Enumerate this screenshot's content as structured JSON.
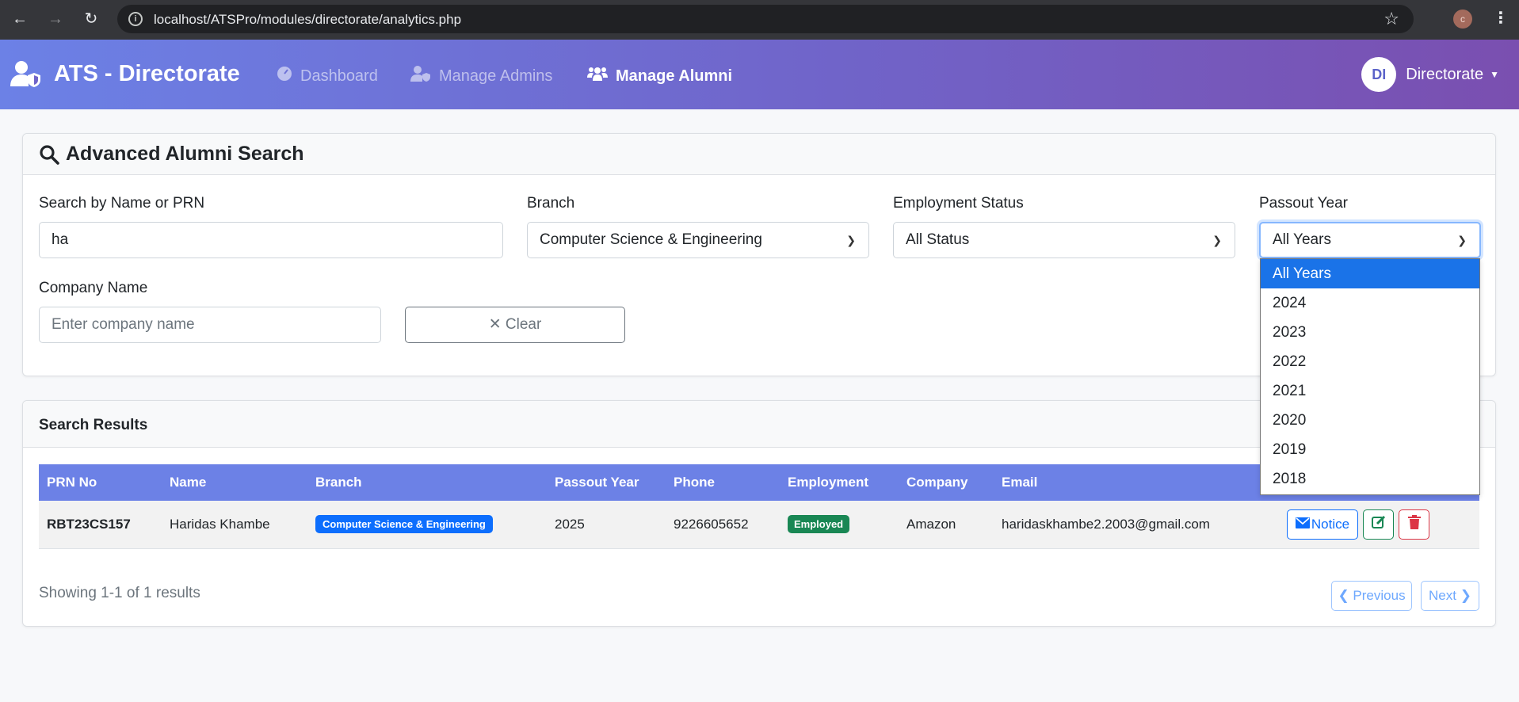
{
  "browser": {
    "url": "localhost/ATSPro/modules/directorate/analytics.php",
    "profile_initial": "c"
  },
  "navbar": {
    "brand": "ATS - Directorate",
    "links": [
      {
        "label": "Dashboard",
        "icon": "gauge-icon",
        "active": false
      },
      {
        "label": "Manage Admins",
        "icon": "user-shield-icon",
        "active": false
      },
      {
        "label": "Manage Alumni",
        "icon": "users-icon",
        "active": true
      }
    ],
    "user": {
      "initials": "DI",
      "name": "Directorate"
    }
  },
  "search": {
    "title": "Advanced Alumni Search",
    "name_label": "Search by Name or PRN",
    "name_value": "ha",
    "branch_label": "Branch",
    "branch_value": "Computer Science & Engineering",
    "status_label": "Employment Status",
    "status_value": "All Status",
    "year_label": "Passout Year",
    "year_value": "All Years",
    "company_label": "Company Name",
    "company_placeholder": "Enter company name",
    "clear_label": "Clear"
  },
  "year_dropdown": {
    "options": [
      "All Years",
      "2024",
      "2023",
      "2022",
      "2021",
      "2020",
      "2019",
      "2018"
    ],
    "selected": "All Years"
  },
  "results": {
    "title": "Search Results",
    "columns": [
      "PRN No",
      "Name",
      "Branch",
      "Passout Year",
      "Phone",
      "Employment",
      "Company",
      "Email"
    ],
    "rows": [
      {
        "prn": "RBT23CS157",
        "name": "Haridas Khambe",
        "branch": "Computer Science & Engineering",
        "year": "2025",
        "phone": "9226605652",
        "employment": "Employed",
        "company": "Amazon",
        "email": "haridaskhambe2.2003@gmail.com"
      }
    ],
    "notice_label": "Notice",
    "showing_text": "Showing 1-1 of 1 results",
    "prev_label": "Previous",
    "next_label": "Next"
  },
  "colors": {
    "navbar_start": "#6c81e6",
    "navbar_end": "#7a4fb0",
    "table_header": "#6c81e6",
    "primary": "#0d6efd",
    "success": "#198754",
    "danger": "#dc3545",
    "dropdown_selected": "#1a73e8"
  }
}
